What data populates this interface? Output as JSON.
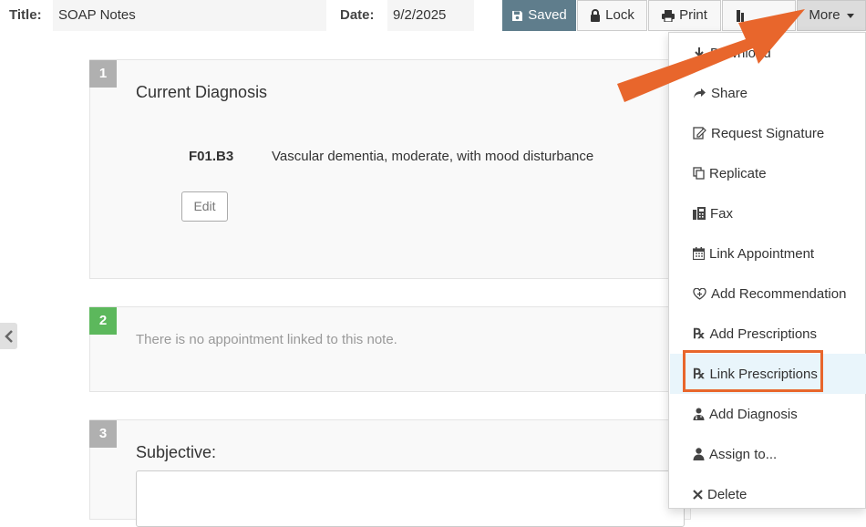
{
  "header": {
    "title_label": "Title:",
    "title_value": "SOAP Notes",
    "date_label": "Date:",
    "date_value": "9/2/2025",
    "saved_label": "Saved",
    "lock_label": "Lock",
    "print_label": "Print",
    "hidden_button_label": "...",
    "more_label": "More"
  },
  "sections": [
    {
      "number": "1",
      "title": "Current Diagnosis",
      "diagnosis_code": "F01.B3",
      "diagnosis_desc": "Vascular dementia, moderate, with mood disturbance",
      "edit_label": "Edit"
    },
    {
      "number": "2",
      "message": "There is no appointment linked to this note."
    },
    {
      "number": "3",
      "title": "Subjective:"
    }
  ],
  "more_menu": {
    "items": [
      {
        "label": "Download",
        "icon": "download-icon"
      },
      {
        "label": "Share",
        "icon": "share-icon"
      },
      {
        "label": "Request Signature",
        "icon": "signature-icon"
      },
      {
        "label": "Replicate",
        "icon": "copy-icon"
      },
      {
        "label": "Fax",
        "icon": "fax-icon"
      },
      {
        "label": "Link Appointment",
        "icon": "calendar-icon"
      },
      {
        "label": "Add Recommendation",
        "icon": "heart-icon"
      },
      {
        "label": "Add Prescriptions",
        "icon": "rx-icon"
      },
      {
        "label": "Link Prescriptions",
        "icon": "rx-icon"
      },
      {
        "label": "Add Diagnosis",
        "icon": "doctor-icon"
      },
      {
        "label": "Assign to...",
        "icon": "user-icon"
      },
      {
        "label": "Delete",
        "icon": "close-icon"
      }
    ]
  },
  "colors": {
    "annotation": "#e8662c",
    "saved_button": "#5f7d8c",
    "section_two_badge": "#5cb85c"
  }
}
